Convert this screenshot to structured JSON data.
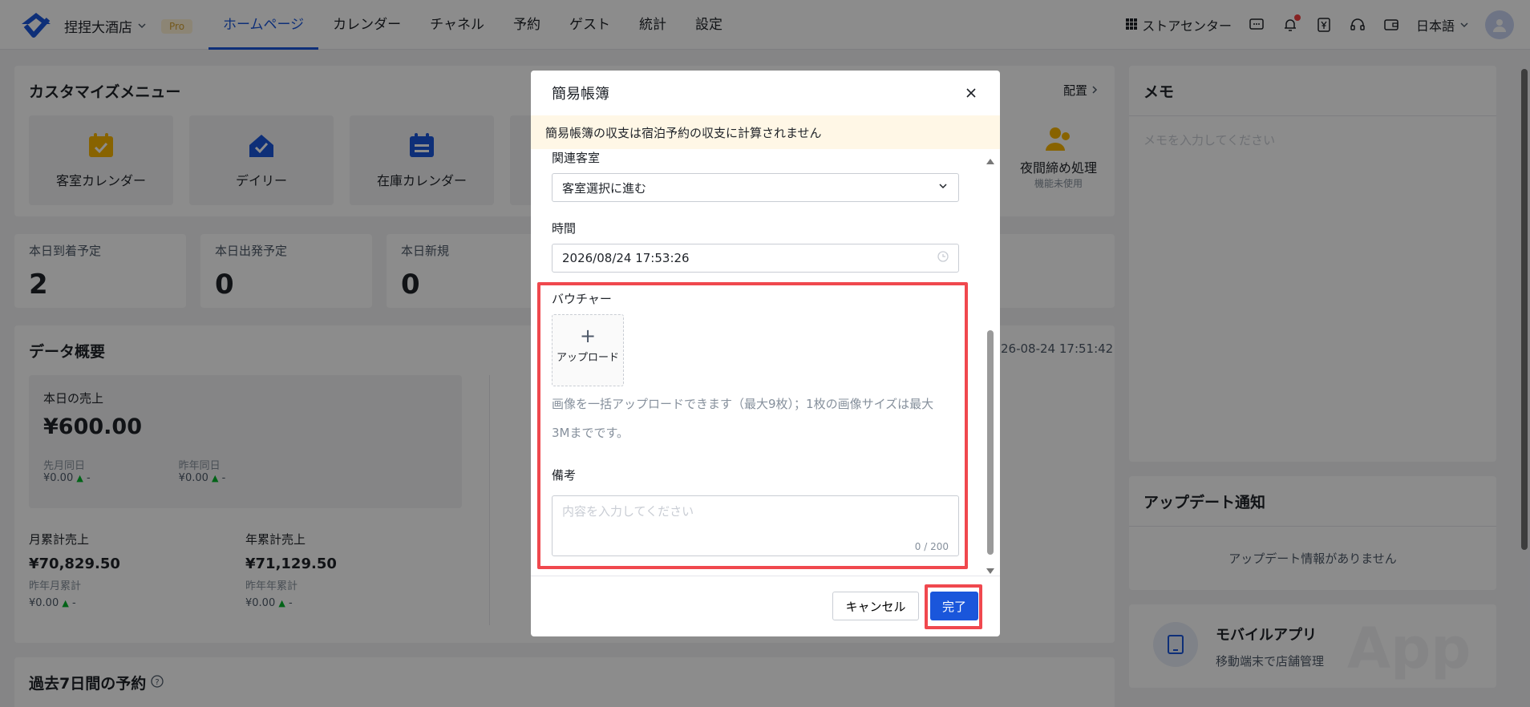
{
  "nav": {
    "hotel_name": "捏捏大酒店",
    "pro_badge": "Pro",
    "tabs": [
      "ホームページ",
      "カレンダー",
      "チャネル",
      "予約",
      "ゲスト",
      "統計",
      "設定"
    ],
    "store_center": "ストアセンター",
    "language": "日本語"
  },
  "custom_menu": {
    "title": "カスタマイズメニュー",
    "config_link": "配置",
    "tiles": [
      "客室カレンダー",
      "デイリー",
      "在庫カレンダー"
    ],
    "night_audit": "夜間締め処理",
    "night_audit_sub": "機能未使用"
  },
  "stats": [
    {
      "label": "本日到着予定",
      "value": "2"
    },
    {
      "label": "本日出発予定",
      "value": "0"
    },
    {
      "label": "本日新規",
      "value": "0"
    }
  ],
  "overview": {
    "title": "データ概要",
    "timestamp": "26-08-24 17:51:42",
    "today_sales_label": "本日の売上",
    "today_sales_value": "¥600.00",
    "prev_month_label": "先月同日",
    "prev_month_value": "¥0.00",
    "prev_year_label": "昨年同日",
    "prev_year_value": "¥0.00",
    "dash": "-",
    "monthly_label": "月累計売上",
    "monthly_value": "¥70,829.50",
    "monthly_sub_label": "昨年月累計",
    "monthly_sub_value": "¥0.00",
    "yearly_label": "年累計売上",
    "yearly_value": "¥71,129.50",
    "yearly_sub_label": "昨年年累計",
    "yearly_sub_value": "¥0.00"
  },
  "last7": {
    "title": "過去7日間の予約"
  },
  "memo": {
    "title": "メモ",
    "placeholder": "メモを入力してください"
  },
  "updates": {
    "title": "アップデート通知",
    "empty": "アップデート情報がありません"
  },
  "mobile": {
    "title": "モバイルアプリ",
    "subtitle": "移動端末で店舗管理",
    "watermark": "App"
  },
  "modal": {
    "title": "簡易帳簿",
    "warning": "簡易帳簿の収支は宿泊予約の収支に計算されません",
    "room_label": "関連客室",
    "room_value": "客室選択に進む",
    "time_label": "時間",
    "time_value": "2026/08/24 17:53:26",
    "voucher_label": "バウチャー",
    "upload_label": "アップロード",
    "hint_line1": "画像を一括アップロードできます（最大9枚）；1枚の画像サイズは最大",
    "hint_line2": "3Mまでです。",
    "note_label": "備考",
    "note_placeholder": "内容を入力してください",
    "note_counter": "0 / 200",
    "cancel": "キャンセル",
    "confirm": "完了"
  }
}
